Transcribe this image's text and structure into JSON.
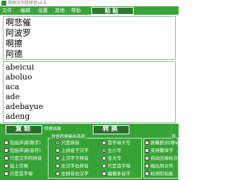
{
  "window": {
    "title": "简明汉字转拼音v4.8"
  },
  "menu": [
    "文件",
    "编辑",
    "设置",
    "其他",
    "帮助"
  ],
  "paste_label": "粘贴",
  "input_lines": [
    "啊悲催",
    "阿波罗",
    "啊擦",
    "阿德"
  ],
  "output_lines": [
    "abeicui",
    "aboluo",
    "aca",
    "ade",
    "adebayue",
    "adeng"
  ],
  "bottom": {
    "copy_label": "复制",
    "convert_label": "转换",
    "result_label": "转换结果",
    "group_title": "拼音转换输出选项",
    "group_title_right": "其",
    "col1": [
      "包括声调(数字)",
      "包括声调(音符)",
      "只是汉字的拼音",
      "加上空格",
      "只是首字母"
    ],
    "col2": [
      "只是拼音",
      "上拼音下汉字",
      "上汉字下拼音",
      "左汉字右拼音",
      "左拼音右汉字"
    ],
    "col3": [
      "首字母大写",
      "全小写",
      "全大写",
      "只是首字母",
      "编辑多音字"
    ],
    "col4": [
      "屏幕抓词(移动",
      "支持繁体字",
      "自动去掉标点",
      "输出到文件",
      "检测剪贴板"
    ]
  }
}
